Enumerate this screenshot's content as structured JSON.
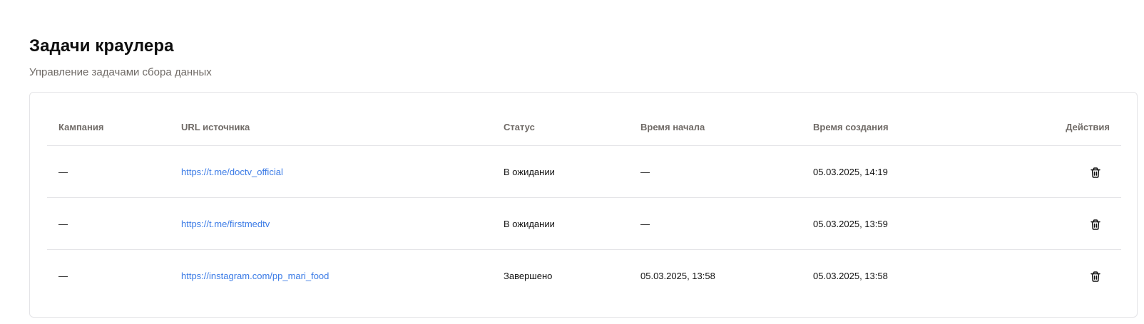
{
  "header": {
    "title": "Задачи краулера",
    "subtitle": "Управление задачами сбора данных"
  },
  "table": {
    "columns": {
      "campaign": "Кампания",
      "url": "URL источника",
      "status": "Статус",
      "start_time": "Время начала",
      "created_time": "Время создания",
      "actions": "Действия"
    },
    "rows": [
      {
        "campaign": "—",
        "url": "https://t.me/doctv_official",
        "status": "В ожидании",
        "start_time": "—",
        "created_time": "05.03.2025, 14:19",
        "action_icon": "trash-icon"
      },
      {
        "campaign": "—",
        "url": "https://t.me/firstmedtv",
        "status": "В ожидании",
        "start_time": "—",
        "created_time": "05.03.2025, 13:59",
        "action_icon": "trash-icon"
      },
      {
        "campaign": "—",
        "url": "https://instagram.com/pp_mari_food",
        "status": "Завершено",
        "start_time": "05.03.2025, 13:58",
        "created_time": "05.03.2025, 13:58",
        "action_icon": "trash-icon"
      }
    ]
  },
  "colors": {
    "link": "#3b7be6",
    "muted_text": "#6f6a66",
    "border": "#e4e4e7"
  }
}
